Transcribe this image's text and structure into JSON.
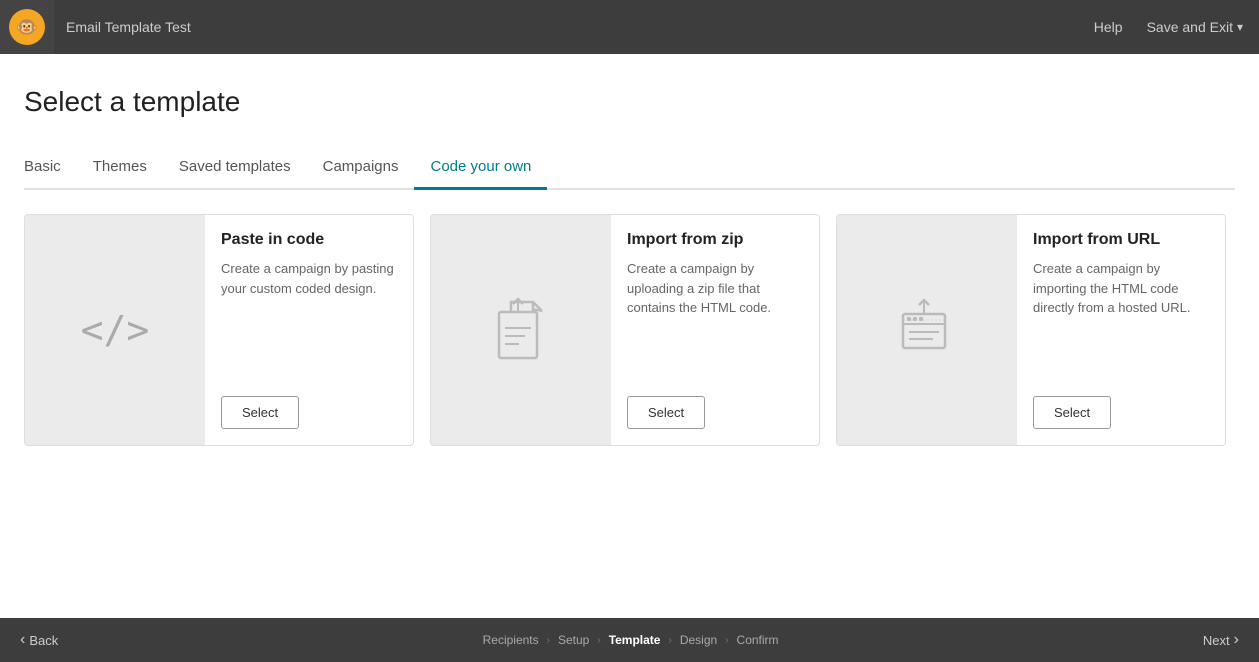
{
  "topNav": {
    "title": "Email Template Test",
    "help": "Help",
    "saveExit": "Save and Exit"
  },
  "page": {
    "title": "Select a template"
  },
  "tabs": [
    {
      "id": "basic",
      "label": "Basic",
      "active": false
    },
    {
      "id": "themes",
      "label": "Themes",
      "active": false
    },
    {
      "id": "saved-templates",
      "label": "Saved templates",
      "active": false
    },
    {
      "id": "campaigns",
      "label": "Campaigns",
      "active": false
    },
    {
      "id": "code-your-own",
      "label": "Code your own",
      "active": true
    }
  ],
  "cards": [
    {
      "id": "paste-in-code",
      "title": "Paste in code",
      "description": "Create a campaign by pasting your custom coded design.",
      "selectLabel": "Select",
      "icon": "code"
    },
    {
      "id": "import-from-zip",
      "title": "Import from zip",
      "description": "Create a campaign by uploading a zip file that contains the HTML code.",
      "selectLabel": "Select",
      "icon": "upload"
    },
    {
      "id": "import-from-url",
      "title": "Import from URL",
      "description": "Create a campaign by importing the HTML code directly from a hosted URL.",
      "selectLabel": "Select",
      "icon": "url-import"
    }
  ],
  "bottomNav": {
    "back": "Back",
    "next": "Next",
    "steps": [
      {
        "label": "Recipients",
        "active": false
      },
      {
        "label": "Setup",
        "active": false
      },
      {
        "label": "Template",
        "active": true
      },
      {
        "label": "Design",
        "active": false
      },
      {
        "label": "Confirm",
        "active": false
      }
    ]
  }
}
